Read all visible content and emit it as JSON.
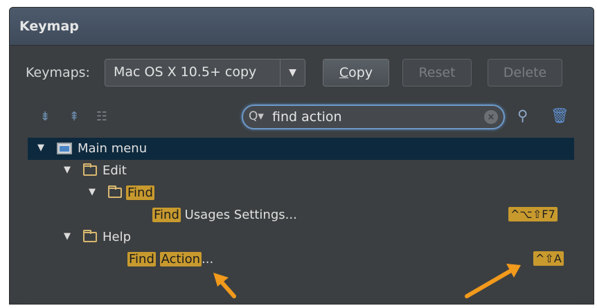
{
  "dialog": {
    "title": "Keymap"
  },
  "keymaps": {
    "label": "Keymaps:",
    "selected": "Mac OS X 10.5+ copy",
    "copy_label_prefix": "C",
    "copy_label_rest": "opy",
    "reset_label": "Reset",
    "delete_label": "Delete"
  },
  "toolbar": {
    "search_value": "find action",
    "clear_glyph": "×",
    "search_glyph": "Q▾"
  },
  "tree": {
    "main_menu": "Main menu",
    "edit": "Edit",
    "find": "Find",
    "find_usages_hl": "Find",
    "find_usages_rest": " Usages Settings...",
    "find_usages_shortcut": "^⌥⇧F7",
    "help": "Help",
    "find_action_hl1": "Find",
    "find_action_hl2": "Action",
    "find_action_rest": "...",
    "find_action_shortcut": "^⇧A"
  },
  "colors": {
    "accent": "#f29a1c",
    "highlight": "#c89a2e",
    "selection": "#0d293e"
  }
}
